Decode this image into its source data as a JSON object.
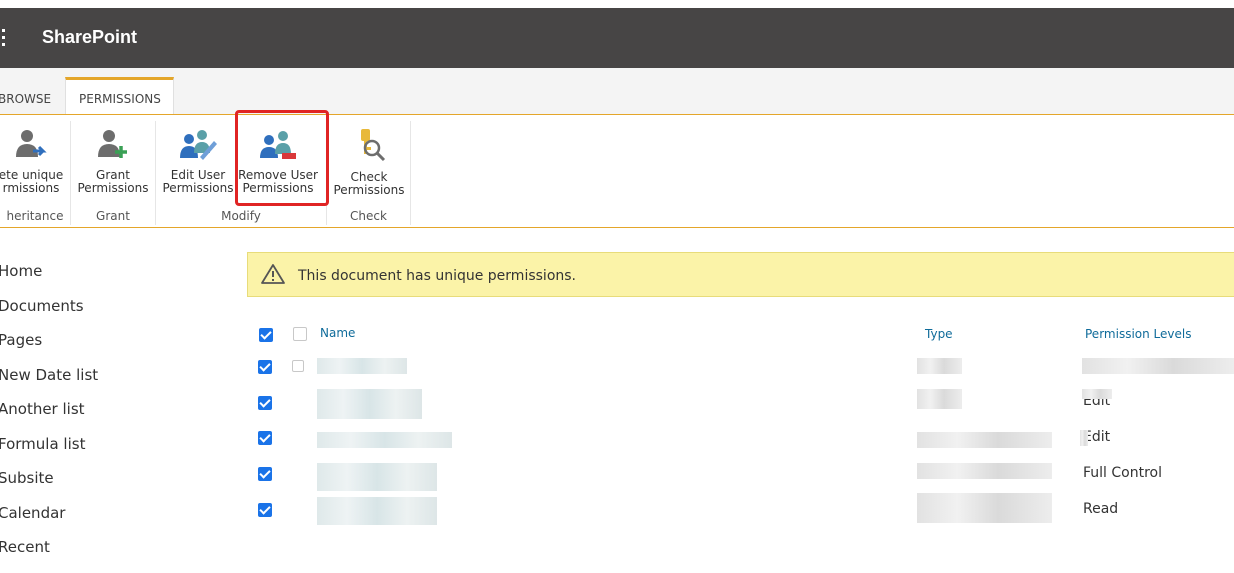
{
  "suite": {
    "brand": "SharePoint"
  },
  "tabs": {
    "browse": "BROWSE",
    "permissions": "PERMISSIONS"
  },
  "ribbon": {
    "groups": {
      "inheritance": "heritance",
      "grant": "Grant",
      "modify": "Modify",
      "check": "Check"
    },
    "buttons": {
      "delete_unique": [
        "ete unique",
        "rmissions"
      ],
      "grant_permissions": [
        "Grant",
        "Permissions"
      ],
      "edit_user_permissions": [
        "Edit User",
        "Permissions"
      ],
      "remove_user_permissions": [
        "Remove User",
        "Permissions"
      ],
      "check_permissions": [
        "Check",
        "Permissions"
      ]
    }
  },
  "nav": [
    "Home",
    "Documents",
    "Pages",
    "New Date list",
    "Another list",
    "Formula list",
    "Subsite",
    "Calendar",
    "Recent"
  ],
  "banner": {
    "text": "This document has unique permissions."
  },
  "table": {
    "headers": {
      "name": "Name",
      "type": "Type",
      "levels": "Permission Levels"
    },
    "rows": [
      {
        "level": ""
      },
      {
        "level": "Edit"
      },
      {
        "level": "Edit"
      },
      {
        "level": "Full Control"
      },
      {
        "level": "Read"
      }
    ]
  },
  "colors": {
    "suitebar": "#474545",
    "accent": "#e4a62a",
    "highlight": "#e02424",
    "banner": "#fbf3a8",
    "link": "#0f6b9a"
  }
}
